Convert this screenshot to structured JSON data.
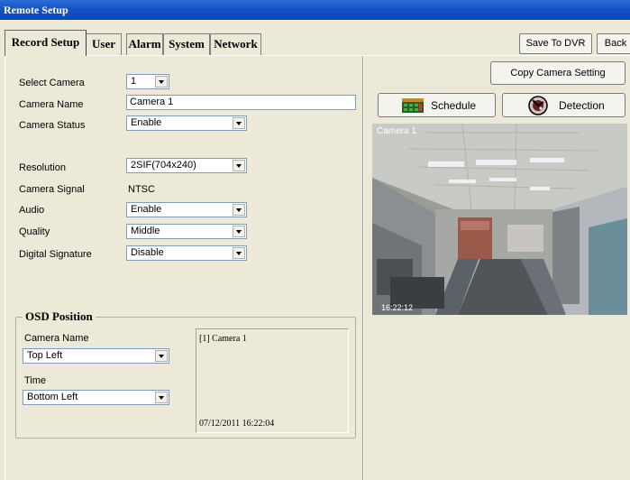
{
  "window": {
    "title": "Remote Setup"
  },
  "tabs": [
    "Record Setup",
    "User",
    "Alarm",
    "System",
    "Network"
  ],
  "top_buttons": {
    "save": "Save To DVR",
    "back": "Back"
  },
  "form": {
    "select_camera": {
      "label": "Select Camera",
      "value": "1"
    },
    "camera_name": {
      "label": "Camera Name",
      "value": "Camera 1"
    },
    "camera_status": {
      "label": "Camera Status",
      "value": "Enable"
    },
    "resolution": {
      "label": "Resolution",
      "value": "2SIF(704x240)"
    },
    "camera_signal": {
      "label": "Camera Signal",
      "value": "NTSC"
    },
    "audio": {
      "label": "Audio",
      "value": "Enable"
    },
    "quality": {
      "label": "Quality",
      "value": "Middle"
    },
    "digital_signature": {
      "label": "Digital Signature",
      "value": "Disable"
    }
  },
  "osd": {
    "title": "OSD Position",
    "camera_name_label": "Camera Name",
    "camera_name_value": "Top Left",
    "time_label": "Time",
    "time_value": "Bottom Left",
    "preview_name": "[1] Camera 1",
    "preview_time": "07/12/2011 16:22:04"
  },
  "right": {
    "copy_button": "Copy Camera Setting",
    "schedule_button": "Schedule",
    "detection_button": "Detection",
    "camera_overlay_name": "Camera 1",
    "camera_overlay_time": "16:22:12"
  },
  "icons": {
    "schedule": "calendar-grid-icon",
    "detection": "radar-icon",
    "dropdown": "chevron-down-icon"
  },
  "colors": {
    "title_bar": "#1550c6",
    "window_bg": "#ece9d8"
  }
}
